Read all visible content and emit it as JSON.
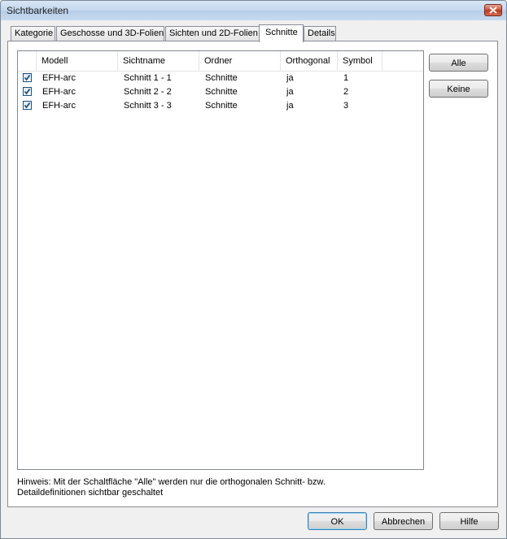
{
  "window": {
    "title": "Sichtbarkeiten"
  },
  "tabs": [
    {
      "label": "Kategorie"
    },
    {
      "label": "Geschosse und 3D-Folien"
    },
    {
      "label": "Sichten und 2D-Folien"
    },
    {
      "label": "Schnitte",
      "active": true
    },
    {
      "label": "Details"
    }
  ],
  "table": {
    "columns": [
      "Modell",
      "Sichtname",
      "Ordner",
      "Orthogonal",
      "Symbol"
    ],
    "rows": [
      {
        "checked": true,
        "modell": "EFH-arc",
        "sichtname": "Schnitt 1 - 1",
        "ordner": "Schnitte",
        "orthogonal": "ja",
        "symbol": "1"
      },
      {
        "checked": true,
        "modell": "EFH-arc",
        "sichtname": "Schnitt 2 - 2",
        "ordner": "Schnitte",
        "orthogonal": "ja",
        "symbol": "2"
      },
      {
        "checked": true,
        "modell": "EFH-arc",
        "sichtname": "Schnitt 3 - 3",
        "ordner": "Schnitte",
        "orthogonal": "ja",
        "symbol": "3"
      }
    ]
  },
  "side_buttons": {
    "all": "Alle",
    "none": "Keine"
  },
  "hint": {
    "line1": "Hinweis: Mit der Schaltfläche \"Alle\" werden nur die orthogonalen Schnitt- bzw.",
    "line2": "Detaildefinitionen sichtbar geschaltet"
  },
  "footer": {
    "ok": "OK",
    "cancel": "Abbrechen",
    "help": "Hilfe"
  },
  "colors": {
    "titlebar": "#c3d7ee",
    "close": "#c0321a",
    "check": "#1c5180"
  }
}
